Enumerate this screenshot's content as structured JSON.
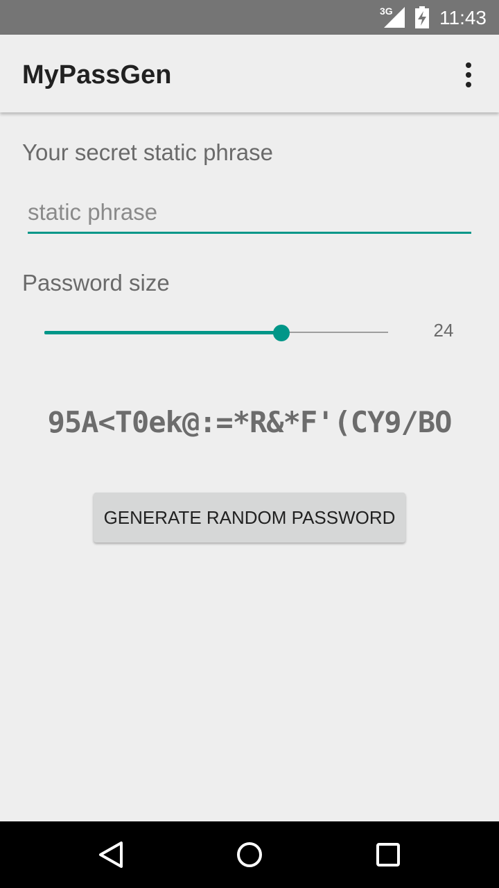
{
  "status_bar": {
    "network": "3G",
    "time": "11:43"
  },
  "app_bar": {
    "title": "MyPassGen",
    "overflow_icon": "more-vert-icon"
  },
  "form": {
    "phrase_label": "Your secret static phrase",
    "phrase_placeholder": "static phrase",
    "phrase_value": "",
    "size_label": "Password size",
    "size_value": "24",
    "slider_fraction": 0.69
  },
  "password": "95A<T0ek@:=*R&*F'(CY9/BO",
  "generate_button_label": "GENERATE RANDOM PASSWORD",
  "nav_bar": {
    "icons": [
      "back-icon",
      "home-icon",
      "recents-icon"
    ]
  },
  "colors": {
    "accent": "#009688",
    "status_bar": "#757575",
    "background": "#eeeeee",
    "button": "#d6d7d7",
    "nav_bar": "#000000"
  }
}
